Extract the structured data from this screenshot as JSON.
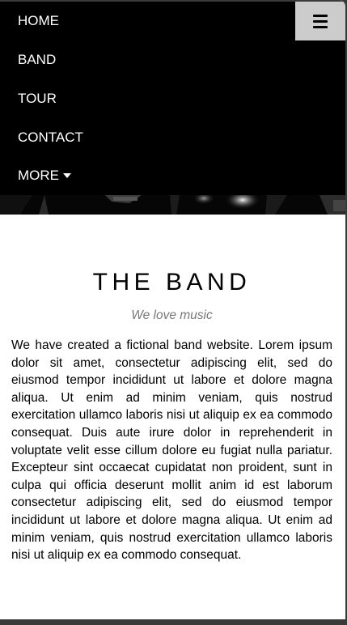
{
  "nav": {
    "items": [
      {
        "label": "HOME"
      },
      {
        "label": "BAND"
      },
      {
        "label": "TOUR"
      },
      {
        "label": "CONTACT"
      },
      {
        "label": "MORE"
      }
    ],
    "more_icon": "caret-down-icon",
    "toggle_icon": "hamburger-menu-icon"
  },
  "band": {
    "title": "THE BAND",
    "subtitle": "We love music",
    "description": "We have created a fictional band website. Lorem ipsum dolor sit amet, consectetur adipiscing elit, sed do eiusmod tempor incididunt ut labore et dolore magna aliqua. Ut enim ad minim veniam, quis nostrud exercitation ullamco laboris nisi ut aliquip ex ea commodo consequat. Duis aute irure dolor in reprehenderit in voluptate velit esse cillum dolore eu fugiat nulla pariatur. Excepteur sint occaecat cupidatat non proident, sunt in culpa qui officia deserunt mollit anim id est laborum consectetur adipiscing elit, sed do eiusmod tempor incididunt ut labore et dolore magna aliqua. Ut enim ad minim veniam, quis nostrud exercitation ullamco laboris nisi ut aliquip ex ea commodo consequat."
  },
  "colors": {
    "nav_background": "#000000",
    "nav_text": "#ffffff",
    "toggle_background": "#cccccc",
    "subtitle_text": "#777777"
  }
}
